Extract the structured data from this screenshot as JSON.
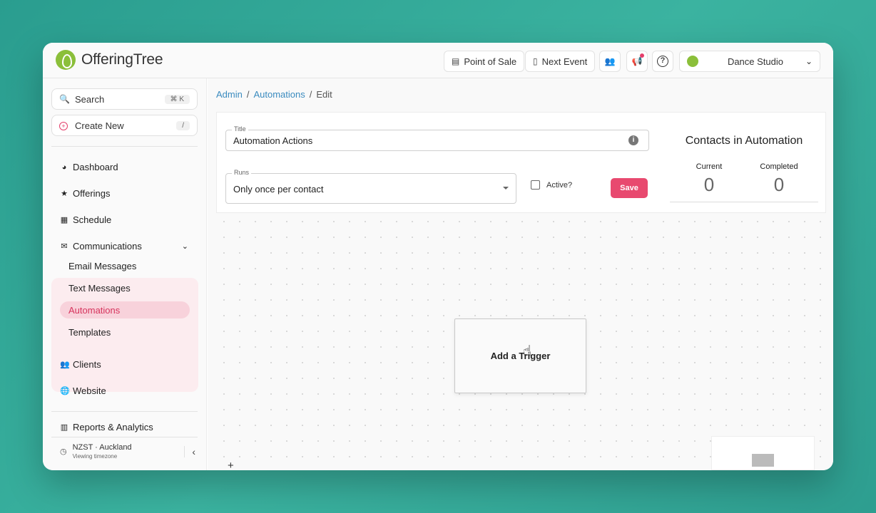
{
  "app": {
    "brand": "OfferingTree"
  },
  "header": {
    "point_of_sale": "Point of Sale",
    "next_event": "Next Event",
    "studio": "Dance Studio"
  },
  "sidebar": {
    "search_label": "Search",
    "search_shortcut": "⌘ K",
    "create_label": "Create New",
    "create_shortcut": "/",
    "items": [
      {
        "label": "Dashboard",
        "icon": "dashboard-icon"
      },
      {
        "label": "Offerings",
        "icon": "star-icon"
      },
      {
        "label": "Schedule",
        "icon": "calendar-icon"
      },
      {
        "label": "Communications",
        "icon": "envelope-icon"
      },
      {
        "label": "Clients",
        "icon": "users-icon"
      },
      {
        "label": "Website",
        "icon": "globe-icon"
      },
      {
        "label": "Reports & Analytics",
        "icon": "chart-icon"
      }
    ],
    "communications_sub": [
      "Email Messages",
      "Text Messages",
      "Automations",
      "Templates"
    ],
    "timezone": {
      "name": "NZST · Auckland",
      "caption": "Viewing timezone"
    }
  },
  "breadcrumb": {
    "admin": "Admin",
    "automations": "Automations",
    "current": "Edit"
  },
  "form": {
    "title_label": "Title",
    "title_value": "Automation Actions",
    "runs_label": "Runs",
    "runs_value": "Only once per contact",
    "active_label": "Active?",
    "active_checked": false,
    "save_label": "Save"
  },
  "contacts": {
    "title": "Contacts in Automation",
    "current_label": "Current",
    "current_value": "0",
    "completed_label": "Completed",
    "completed_value": "0"
  },
  "canvas": {
    "trigger_label": "Add a Trigger",
    "zoom_in": "+"
  },
  "colors": {
    "accent": "#e8496f",
    "link": "#3a8bbf",
    "brand": "#8bbf3a"
  }
}
